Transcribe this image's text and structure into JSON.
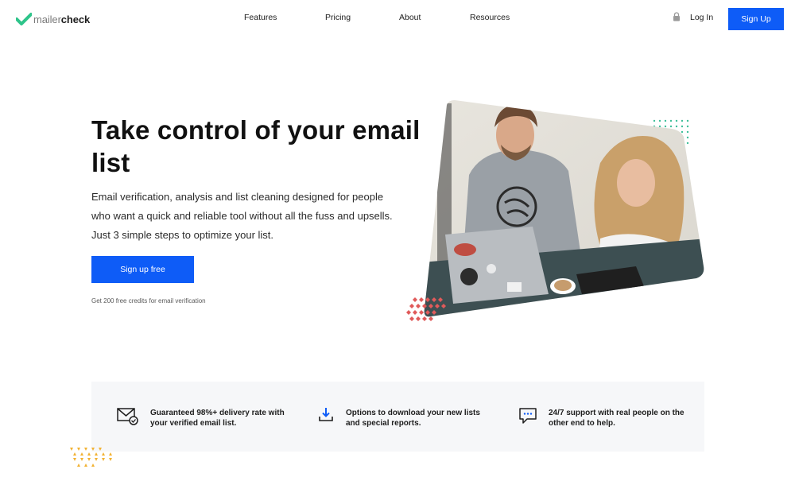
{
  "brand": {
    "logo_light": "mailer",
    "logo_bold": "check",
    "accent_color": "#0e5cf7",
    "logo_color": "#2ec48a"
  },
  "nav": {
    "items": [
      {
        "label": "Features"
      },
      {
        "label": "Pricing"
      },
      {
        "label": "About"
      },
      {
        "label": "Resources"
      }
    ],
    "login_label": "Log In",
    "signup_label": "Sign Up"
  },
  "hero": {
    "title": "Take control of your email list",
    "description": "Email verification, analysis and list cleaning designed for people who want a quick and reliable tool without all the fuss and upsells. Just 3 simple steps to optimize your list.",
    "cta_label": "Sign up free",
    "note": "Get 200 free credits for email verification"
  },
  "features": [
    {
      "icon": "envelope-check-icon",
      "text": "Guaranteed 98%+ delivery rate with your verified email list."
    },
    {
      "icon": "download-icon",
      "text": "Options to download your new lists and special reports."
    },
    {
      "icon": "chat-bubble-icon",
      "text": "24/7 support with real people on the other end to help."
    }
  ]
}
